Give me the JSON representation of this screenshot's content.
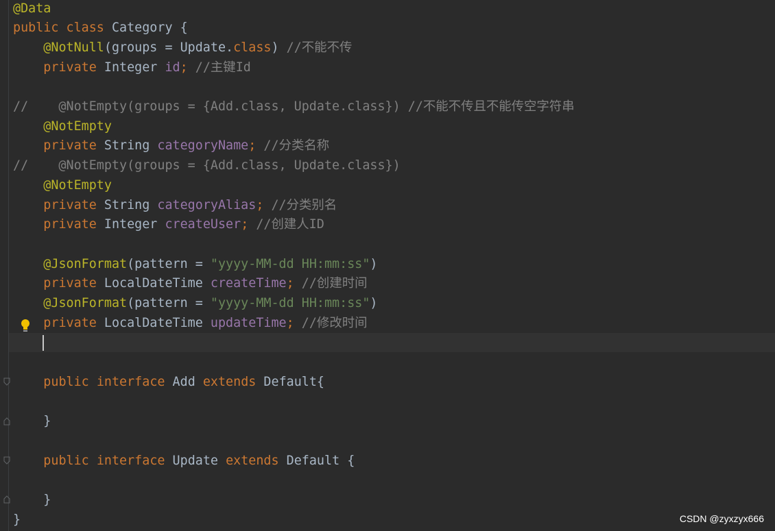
{
  "code": {
    "lines": [
      [
        {
          "t": "@Data",
          "c": "annotation"
        }
      ],
      [
        {
          "t": "public class ",
          "c": "keyword"
        },
        {
          "t": "Category {",
          "c": "default"
        }
      ],
      [
        {
          "t": "    ",
          "c": "default"
        },
        {
          "t": "@NotNull",
          "c": "annotation"
        },
        {
          "t": "(groups = Update.",
          "c": "default"
        },
        {
          "t": "class",
          "c": "keyword"
        },
        {
          "t": ") ",
          "c": "default"
        },
        {
          "t": "//不能不传",
          "c": "comment"
        }
      ],
      [
        {
          "t": "    ",
          "c": "default"
        },
        {
          "t": "private ",
          "c": "keyword"
        },
        {
          "t": "Integer ",
          "c": "default"
        },
        {
          "t": "id",
          "c": "field"
        },
        {
          "t": "; ",
          "c": "keyword"
        },
        {
          "t": "//主键Id",
          "c": "comment"
        }
      ],
      [],
      [
        {
          "t": "//    @NotEmpty(groups = {Add.class, Update.class}) //不能不传且不能传空字符串",
          "c": "comment"
        }
      ],
      [
        {
          "t": "    ",
          "c": "default"
        },
        {
          "t": "@NotEmpty",
          "c": "annotation"
        }
      ],
      [
        {
          "t": "    ",
          "c": "default"
        },
        {
          "t": "private ",
          "c": "keyword"
        },
        {
          "t": "String ",
          "c": "default"
        },
        {
          "t": "categoryName",
          "c": "field"
        },
        {
          "t": "; ",
          "c": "keyword"
        },
        {
          "t": "//分类名称",
          "c": "comment"
        }
      ],
      [
        {
          "t": "//    @NotEmpty(groups = {Add.class, Update.class})",
          "c": "comment"
        }
      ],
      [
        {
          "t": "    ",
          "c": "default"
        },
        {
          "t": "@NotEmpty",
          "c": "annotation"
        }
      ],
      [
        {
          "t": "    ",
          "c": "default"
        },
        {
          "t": "private ",
          "c": "keyword"
        },
        {
          "t": "String ",
          "c": "default"
        },
        {
          "t": "categoryAlias",
          "c": "field"
        },
        {
          "t": "; ",
          "c": "keyword"
        },
        {
          "t": "//分类别名",
          "c": "comment"
        }
      ],
      [
        {
          "t": "    ",
          "c": "default"
        },
        {
          "t": "private ",
          "c": "keyword"
        },
        {
          "t": "Integer ",
          "c": "default"
        },
        {
          "t": "createUser",
          "c": "field"
        },
        {
          "t": "; ",
          "c": "keyword"
        },
        {
          "t": "//创建人ID",
          "c": "comment"
        }
      ],
      [],
      [
        {
          "t": "    ",
          "c": "default"
        },
        {
          "t": "@JsonFormat",
          "c": "annotation"
        },
        {
          "t": "(pattern = ",
          "c": "default"
        },
        {
          "t": "\"yyyy-MM-dd HH:mm:ss\"",
          "c": "string"
        },
        {
          "t": ")",
          "c": "default"
        }
      ],
      [
        {
          "t": "    ",
          "c": "default"
        },
        {
          "t": "private ",
          "c": "keyword"
        },
        {
          "t": "LocalDateTime ",
          "c": "default"
        },
        {
          "t": "createTime",
          "c": "field"
        },
        {
          "t": "; ",
          "c": "keyword"
        },
        {
          "t": "//创建时间",
          "c": "comment"
        }
      ],
      [
        {
          "t": "    ",
          "c": "default"
        },
        {
          "t": "@JsonFormat",
          "c": "annotation"
        },
        {
          "t": "(pattern = ",
          "c": "default"
        },
        {
          "t": "\"yyyy-MM-dd HH:mm:ss\"",
          "c": "string"
        },
        {
          "t": ")",
          "c": "default"
        }
      ],
      [
        {
          "t": "    ",
          "c": "default"
        },
        {
          "t": "private ",
          "c": "keyword"
        },
        {
          "t": "LocalDateTime ",
          "c": "default"
        },
        {
          "t": "updateTime",
          "c": "field"
        },
        {
          "t": "; ",
          "c": "keyword"
        },
        {
          "t": "//修改时间",
          "c": "comment"
        }
      ],
      [],
      [],
      [
        {
          "t": "    ",
          "c": "default"
        },
        {
          "t": "public ",
          "c": "keyword"
        },
        {
          "t": "interface ",
          "c": "keyword"
        },
        {
          "t": "Add ",
          "c": "default"
        },
        {
          "t": "extends ",
          "c": "keyword"
        },
        {
          "t": "Default{",
          "c": "default"
        }
      ],
      [],
      [
        {
          "t": "    }",
          "c": "default"
        }
      ],
      [],
      [
        {
          "t": "    ",
          "c": "default"
        },
        {
          "t": "public ",
          "c": "keyword"
        },
        {
          "t": "interface ",
          "c": "keyword"
        },
        {
          "t": "Update ",
          "c": "default"
        },
        {
          "t": "extends ",
          "c": "keyword"
        },
        {
          "t": "Default {",
          "c": "default"
        }
      ],
      [],
      [
        {
          "t": "    }",
          "c": "default"
        }
      ],
      [
        {
          "t": "}",
          "c": "default"
        }
      ]
    ]
  },
  "colors": {
    "background": "#2b2b2b",
    "annotation": "#bbb529",
    "keyword": "#cc7832",
    "comment": "#808080",
    "field": "#9876aa",
    "string": "#6a8759",
    "default": "#a9b7c6"
  },
  "icons": {
    "intention": "lightbulb-icon",
    "fold": "fold-marker-icon"
  },
  "watermark": "CSDN @zyxzyx666"
}
